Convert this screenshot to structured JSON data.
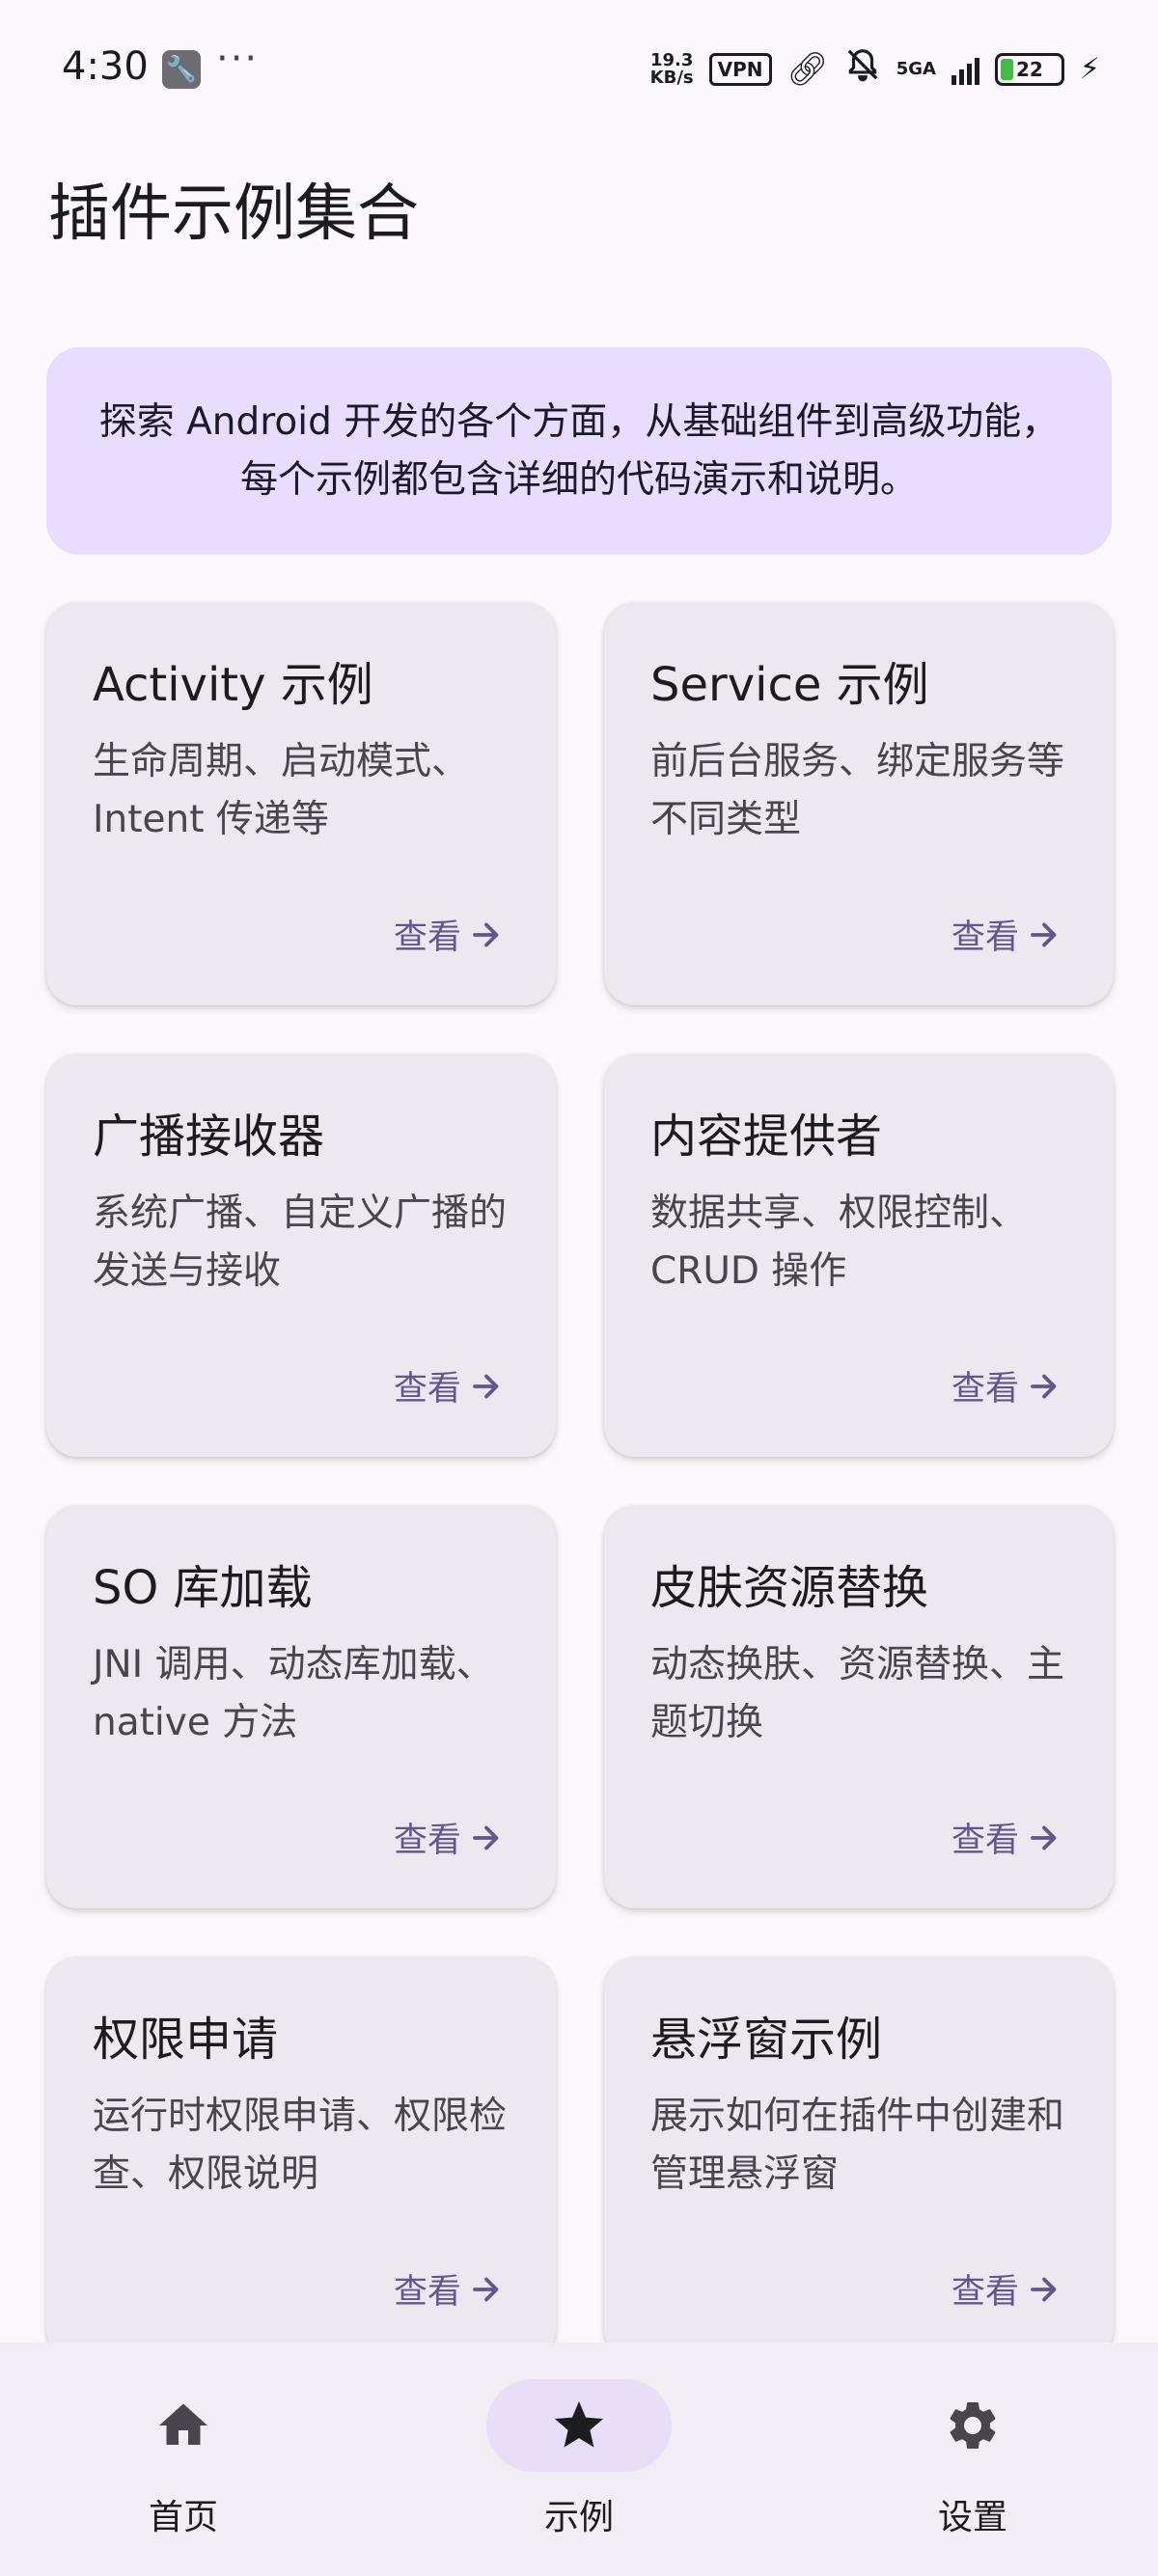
{
  "status_bar": {
    "time": "4:30",
    "more": "···",
    "net_speed_value": "19.3",
    "net_speed_unit": "KB/s",
    "vpn": "VPN",
    "network": "5GA",
    "battery": "22"
  },
  "header": {
    "title": "插件示例集合"
  },
  "intro": {
    "text": "探索 Android 开发的各个方面，从基础组件到高级功能，每个示例都包含详细的代码演示和说明。"
  },
  "cards": [
    {
      "title": "Activity 示例",
      "desc": "生命周期、启动模式、Intent 传递等",
      "link": "查看"
    },
    {
      "title": "Service 示例",
      "desc": "前后台服务、绑定服务等不同类型",
      "link": "查看"
    },
    {
      "title": "广播接收器",
      "desc": "系统广播、自定义广播的发送与接收",
      "link": "查看"
    },
    {
      "title": "内容提供者",
      "desc": "数据共享、权限控制、CRUD 操作",
      "link": "查看"
    },
    {
      "title": "SO 库加载",
      "desc": "JNI 调用、动态库加载、native 方法",
      "link": "查看"
    },
    {
      "title": "皮肤资源替换",
      "desc": "动态换肤、资源替换、主题切换",
      "link": "查看"
    },
    {
      "title": "权限申请",
      "desc": "运行时权限申请、权限检查、权限说明",
      "link": "查看"
    },
    {
      "title": "悬浮窗示例",
      "desc": "展示如何在插件中创建和管理悬浮窗",
      "link": "查看"
    }
  ],
  "bottom_nav": {
    "items": [
      {
        "label": "首页",
        "icon": "home-icon"
      },
      {
        "label": "示例",
        "icon": "star-icon",
        "active": true
      },
      {
        "label": "设置",
        "icon": "gear-icon"
      }
    ]
  },
  "colors": {
    "background": "#fbf7fc",
    "intro_bg": "#e9ddff",
    "card_bg": "#ede7f0",
    "accent": "#65558f",
    "nav_bg": "#f2ecf5",
    "nav_active_pill": "#e8def8"
  }
}
